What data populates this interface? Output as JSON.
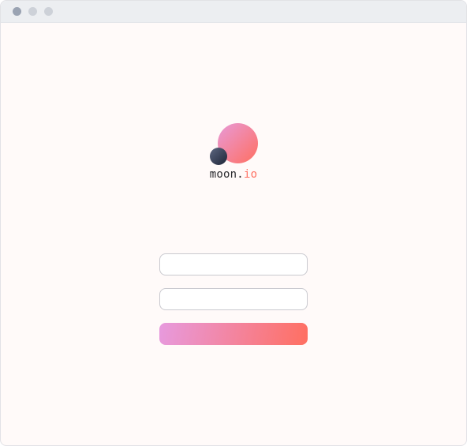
{
  "window": {
    "traffic_lights": [
      "close-dot",
      "minimize-dot",
      "maximize-dot"
    ]
  },
  "brand": {
    "name_primary": "moon.",
    "name_accent": "io",
    "colors": {
      "accent": "#ff6f61",
      "gradient_start": "#e89ad8",
      "small_moon": "#2a3247"
    }
  },
  "login": {
    "username_value": "",
    "username_placeholder": "",
    "password_value": "",
    "password_placeholder": "",
    "submit_label": ""
  }
}
